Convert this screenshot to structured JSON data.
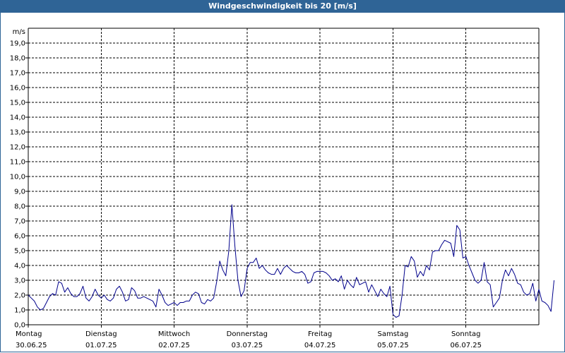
{
  "window": {
    "title": "Windgeschwindigkeit bis 20 [m/s]"
  },
  "chart_data": {
    "type": "line",
    "title": "Windgeschwindigkeit bis 20 [m/s]",
    "ylabel": "m/s",
    "xlabel": "",
    "ylim": [
      0,
      20
    ],
    "yticks": [
      "0,0",
      "1,0",
      "2,0",
      "3,0",
      "4,0",
      "5,0",
      "6,0",
      "7,0",
      "8,0",
      "9,0",
      "10,0",
      "11,0",
      "12,0",
      "13,0",
      "14,0",
      "15,0",
      "16,0",
      "17,0",
      "18,0",
      "19,0"
    ],
    "grid": true,
    "x_unit": "days since 30.06.25 00:00",
    "xlim": [
      0,
      7
    ],
    "day_labels": [
      {
        "day": "Montag",
        "date": "30.06.25"
      },
      {
        "day": "Dienstag",
        "date": "01.07.25"
      },
      {
        "day": "Mittwoch",
        "date": "02.07.25"
      },
      {
        "day": "Donnerstag",
        "date": "03.07.25"
      },
      {
        "day": "Freitag",
        "date": "04.07.25"
      },
      {
        "day": "Samstag",
        "date": "05.07.25"
      },
      {
        "day": "Sonntag",
        "date": "06.07.25"
      }
    ],
    "series": [
      {
        "name": "",
        "color": "#00008b",
        "step_hours": 1,
        "values": [
          2.0,
          1.8,
          1.6,
          1.2,
          1.0,
          1.1,
          1.5,
          1.9,
          2.1,
          2.0,
          2.9,
          2.8,
          2.2,
          2.5,
          2.1,
          1.9,
          1.9,
          2.1,
          2.6,
          1.8,
          1.6,
          1.9,
          2.4,
          2.0,
          1.8,
          2.0,
          1.7,
          1.6,
          1.8,
          2.4,
          2.6,
          2.2,
          1.6,
          1.7,
          2.5,
          2.3,
          1.8,
          1.8,
          1.9,
          1.8,
          1.7,
          1.6,
          1.2,
          2.4,
          2.0,
          1.5,
          1.3,
          1.4,
          1.5,
          1.3,
          1.5,
          1.5,
          1.6,
          1.6,
          2.0,
          2.2,
          2.1,
          1.5,
          1.4,
          1.7,
          1.6,
          1.8,
          2.9,
          4.3,
          3.7,
          3.3,
          5.0,
          8.1,
          5.3,
          3.0,
          1.9,
          2.3,
          3.8,
          4.2,
          4.2,
          4.5,
          3.8,
          4.0,
          3.7,
          3.5,
          3.4,
          3.4,
          3.8,
          3.4,
          3.8,
          4.0,
          3.8,
          3.6,
          3.5,
          3.5,
          3.6,
          3.4,
          2.8,
          2.9,
          3.5,
          3.6,
          3.6,
          3.6,
          3.5,
          3.3,
          3.0,
          3.1,
          2.9,
          3.3,
          2.4,
          3.0,
          2.7,
          2.5,
          3.2,
          2.7,
          2.8,
          2.9,
          2.2,
          2.7,
          2.3,
          1.9,
          2.4,
          2.1,
          1.9,
          2.6,
          0.7,
          0.5,
          0.6,
          2.0,
          4.0,
          3.9,
          4.6,
          4.3,
          3.2,
          3.6,
          3.3,
          4.0,
          3.7,
          4.9,
          5.0,
          5.0,
          5.4,
          5.7,
          5.6,
          5.5,
          4.6,
          6.7,
          6.4,
          4.5,
          4.6,
          4.0,
          3.5,
          3.0,
          2.8,
          3.0,
          4.2,
          2.9,
          2.7,
          1.2,
          1.5,
          1.8,
          3.0,
          3.7,
          3.3,
          3.8,
          3.4,
          2.8,
          2.7,
          2.2,
          2.0,
          2.1,
          2.8,
          1.6,
          2.4,
          1.6,
          1.5,
          1.3,
          0.9,
          3.0
        ]
      }
    ]
  }
}
